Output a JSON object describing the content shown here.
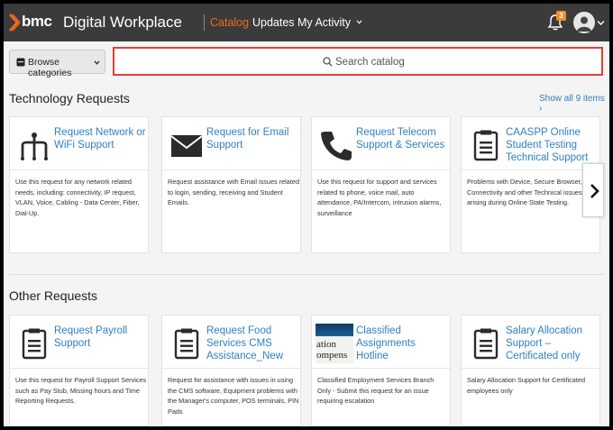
{
  "header": {
    "logo": "bmc",
    "app_name": "Digital Workplace",
    "nav": [
      {
        "label": "Catalog",
        "active": true
      },
      {
        "label": "Updates",
        "active": false
      },
      {
        "label": "My Activity",
        "active": false
      }
    ],
    "notification_count": "3",
    "icons": {
      "bell": "bell-icon",
      "avatar": "user-avatar-icon",
      "chevron": "chevron-down-icon"
    }
  },
  "search": {
    "browse_label": "Browse categories",
    "placeholder": "Search catalog"
  },
  "colors": {
    "header_bg": "#3b3b3b",
    "accent": "#f26a21",
    "link": "#2f7fc1",
    "highlight_border": "#e0403a"
  },
  "technology": {
    "title": "Technology Requests",
    "show_all": "Show all 9 items",
    "cards": [
      {
        "title": "Request Network or WiFi Support",
        "icon": "network-icon",
        "desc": "Use this request for any network related needs, including: connectivity, IP request, VLAN, Voice, Cabling - Data Center, Fiber, Dial-Up."
      },
      {
        "title": "Request for Email Support",
        "icon": "envelope-icon",
        "desc": "Request assistance with Email issues related to login, sending, receiving and Student Emails."
      },
      {
        "title": "Request Telecom Support & Services",
        "icon": "phone-icon",
        "desc": "Use this request for support and services related to phone, voice mail, auto attendance, PA/Intercom, intrusion alarms, surveillance"
      },
      {
        "title": "CAASPP Online Student Testing Technical Support",
        "icon": "clipboard-icon",
        "desc": "Problems with Device, Secure Browser, Connectivity and other Technical issues arising during Online State Testing."
      }
    ]
  },
  "other": {
    "title": "Other Requests",
    "cards": [
      {
        "title": "Request Payroll Support",
        "icon": "clipboard-icon",
        "desc": "Use this request for Payroll Support Services such as Pay Stub, Missing hours and Time Reporting Requests."
      },
      {
        "title": "Request Food Services CMS Assistance_New",
        "icon": "clipboard-icon",
        "desc": "Request for assistance with issues in using the CMS software, Equipment problems with the Manager's computer, POS terminals, PIN Pads"
      },
      {
        "title": "Classified Assignments Hotline",
        "icon": "classified-image-icon",
        "thumb_text": [
          "ation",
          "ompens"
        ],
        "desc": "Classified Employment Services Branch Only - Submit this request for an issue requiring escalation"
      },
      {
        "title": "Salary Allocation Support – Certificated only",
        "icon": "clipboard-icon",
        "desc": "Salary Allocation Support for Certificated employees only"
      }
    ]
  }
}
